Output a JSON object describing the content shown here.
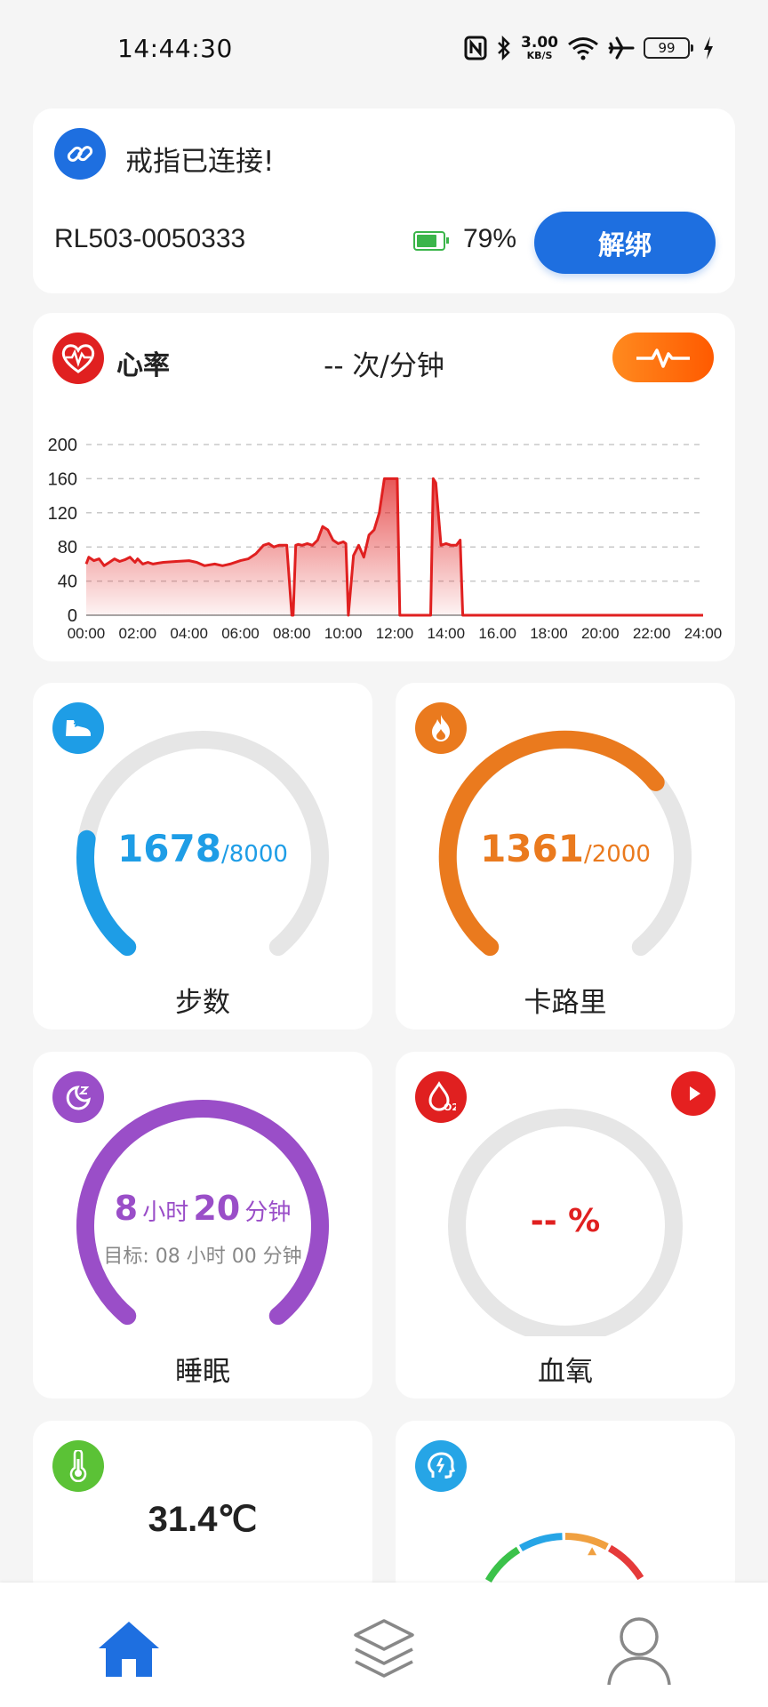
{
  "status_bar": {
    "time": "14:44:30",
    "net_speed_value": "3.00",
    "net_speed_unit": "KB/S",
    "battery": "99"
  },
  "connection": {
    "title": "戒指已连接!",
    "device_id": "RL503-0050333",
    "battery_percent": "79%",
    "battery_level": 0.79,
    "unbind_label": "解绑"
  },
  "heart_rate": {
    "title": "心率",
    "value_text": "-- 次/分钟"
  },
  "chart_data": {
    "type": "area",
    "title": "",
    "xlabel": "",
    "ylabel": "",
    "x_ticks": [
      "00:00",
      "02:00",
      "04:00",
      "06:00",
      "08:00",
      "10:00",
      "12:00",
      "14:00",
      "16.00",
      "18:00",
      "20:00",
      "22:00",
      "24:00"
    ],
    "y_ticks": [
      0,
      40,
      80,
      120,
      160,
      200
    ],
    "xlim": [
      0,
      24
    ],
    "ylim": [
      0,
      200
    ],
    "grid": true,
    "series": [
      {
        "color": "#e02020",
        "x": [
          0,
          0.1,
          0.3,
          0.5,
          0.7,
          0.9,
          1.1,
          1.3,
          1.5,
          1.7,
          1.9,
          2.0,
          2.2,
          2.4,
          2.6,
          2.8,
          3.0,
          3.5,
          4.0,
          4.3,
          4.6,
          5.0,
          5.3,
          5.6,
          6.0,
          6.3,
          6.6,
          6.9,
          7.1,
          7.3,
          7.5,
          7.6,
          7.8,
          8.0,
          8.05,
          8.15,
          8.25,
          8.4,
          8.6,
          8.8,
          9.0,
          9.2,
          9.4,
          9.6,
          9.8,
          10.0,
          10.1,
          10.2,
          10.4,
          10.6,
          10.8,
          11.0,
          11.2,
          11.4,
          11.6,
          11.8,
          12.1,
          12.2,
          12.4,
          12.8,
          13.2,
          13.4,
          13.5,
          13.6,
          13.8,
          14.0,
          14.2,
          14.4,
          14.55,
          14.65,
          14.7,
          15.0,
          24.0
        ],
        "y": [
          60,
          68,
          64,
          66,
          58,
          62,
          66,
          63,
          65,
          68,
          62,
          66,
          60,
          62,
          60,
          61,
          62,
          63,
          64,
          62,
          58,
          60,
          58,
          60,
          64,
          66,
          72,
          82,
          84,
          80,
          82,
          82,
          82,
          0,
          0,
          82,
          83,
          82,
          84,
          82,
          88,
          104,
          100,
          88,
          84,
          86,
          84,
          0,
          70,
          82,
          68,
          94,
          100,
          120,
          160,
          160,
          160,
          0,
          0,
          0,
          0,
          0,
          160,
          155,
          82,
          84,
          82,
          82,
          88,
          0,
          0,
          0,
          0
        ]
      }
    ]
  },
  "steps": {
    "value": "1678",
    "goal": "/8000",
    "label": "步数",
    "progress": 0.21,
    "color": "#1e9de6"
  },
  "calories": {
    "value": "1361",
    "goal": "/2000",
    "label": "卡路里",
    "progress": 0.68,
    "color": "#ea7a1e"
  },
  "sleep": {
    "hours": "8",
    "hours_unit": "小时",
    "minutes": "20",
    "minutes_unit": "分钟",
    "goal_text": "目标: 08 小时 00 分钟",
    "label": "睡眠",
    "progress": 1.0,
    "color": "#9a4ec8"
  },
  "spo2": {
    "value_text": "-- %",
    "label": "血氧",
    "color": "#e02020"
  },
  "temperature": {
    "value": "31.4℃"
  },
  "stress": {
    "segments": [
      "#3bc24a",
      "#26a5e6",
      "#f0a040",
      "#e53a3a"
    ]
  },
  "nav": {
    "active_color": "#1e6fe0",
    "inactive_color": "#888888"
  }
}
